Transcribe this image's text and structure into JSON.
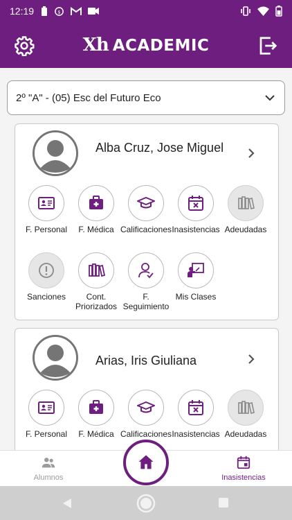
{
  "status_bar": {
    "time": "12:19"
  },
  "app": {
    "brand_mark": "Xh",
    "brand_name": "ACADEMIC"
  },
  "selector": {
    "value": "2º \"A\" - (05) Esc del Futuro Eco"
  },
  "students": [
    {
      "name": "Alba Cruz, Jose Miguel",
      "items": [
        {
          "label": "F. Personal",
          "icon": "id-card-icon"
        },
        {
          "label": "F. Médica",
          "icon": "medical-kit-icon"
        },
        {
          "label": "Calificaciones",
          "icon": "graduation-cap-icon"
        },
        {
          "label": "Inasistencias",
          "icon": "calendar-x-icon"
        },
        {
          "label": "Adeudadas",
          "icon": "books-icon"
        },
        {
          "label": "Sanciones",
          "icon": "alert-icon"
        },
        {
          "label": "Cont. Priorizados",
          "icon": "books-outline-icon"
        },
        {
          "label": "F. Seguimiento",
          "icon": "user-tracking-icon"
        },
        {
          "label": "Mis Clases",
          "icon": "teacher-board-icon"
        }
      ]
    },
    {
      "name": "Arias, Iris Giuliana",
      "items": [
        {
          "label": "F. Personal",
          "icon": "id-card-icon"
        },
        {
          "label": "F. Médica",
          "icon": "medical-kit-icon"
        },
        {
          "label": "Calificaciones",
          "icon": "graduation-cap-icon"
        },
        {
          "label": "Inasistencias",
          "icon": "calendar-x-icon"
        },
        {
          "label": "Adeudadas",
          "icon": "books-icon"
        }
      ]
    }
  ],
  "bottom_nav": {
    "left": "Alumnos",
    "right": "Inasistencias"
  },
  "colors": {
    "primary": "#6e1e7f",
    "disabled_circle": "#e6e6e6",
    "inactive_nav": "#9b9b9b"
  }
}
